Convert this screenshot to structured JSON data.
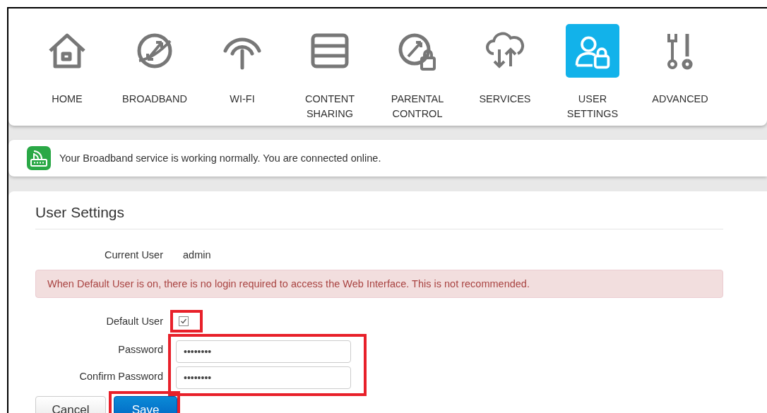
{
  "nav": [
    {
      "label": "HOME",
      "selected": false
    },
    {
      "label": "BROADBAND",
      "selected": false
    },
    {
      "label": "WI-FI",
      "selected": false
    },
    {
      "label": "CONTENT SHARING",
      "selected": false
    },
    {
      "label": "PARENTAL CONTROL",
      "selected": false
    },
    {
      "label": "SERVICES",
      "selected": false
    },
    {
      "label": "USER SETTINGS",
      "selected": true
    },
    {
      "label": "ADVANCED",
      "selected": false
    }
  ],
  "status": {
    "message": "Your Broadband service is working normally. You are connected online."
  },
  "panel": {
    "title": "User Settings",
    "current_user": {
      "label": "Current User",
      "value": "admin"
    },
    "alert": "When Default User is on, there is no login required to access the Web Interface. This is not recommended.",
    "default_user": {
      "label": "Default User",
      "checked": true
    },
    "password": {
      "label": "Password",
      "value": "••••••••"
    },
    "confirm_password": {
      "label": "Confirm Password",
      "value": "••••••••"
    },
    "buttons": [
      {
        "label": "Cancel",
        "kind": "secondary"
      },
      {
        "label": "Save",
        "kind": "primary"
      }
    ]
  }
}
